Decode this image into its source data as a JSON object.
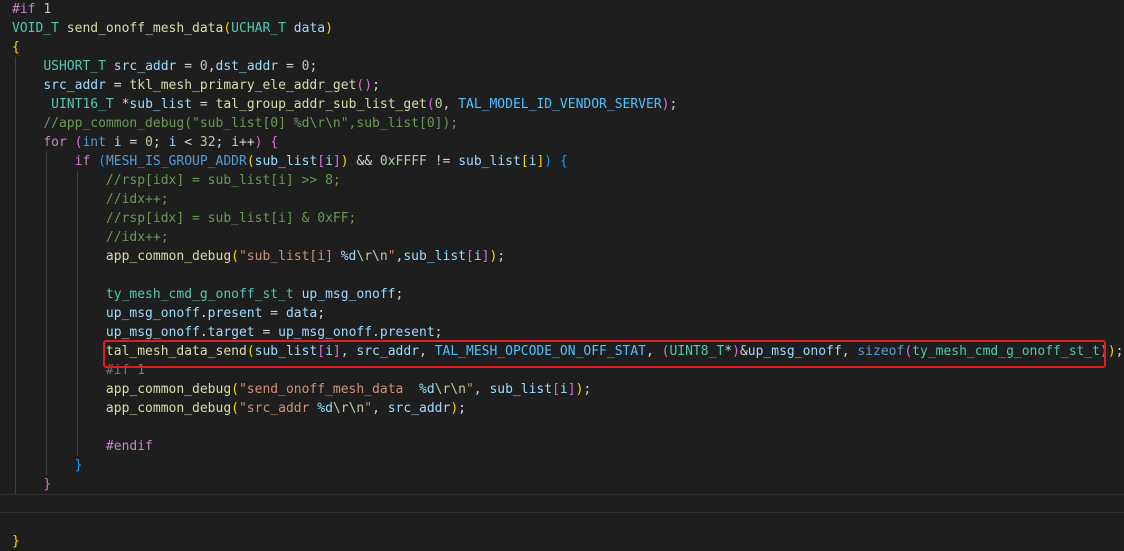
{
  "colors": {
    "background": "#1e1e1e",
    "keyword": "#569cd6",
    "control": "#c586c0",
    "type": "#4ec9b0",
    "function": "#dcdcaa",
    "variable": "#9cdcfe",
    "number": "#b5cea8",
    "string": "#ce9178",
    "comment": "#6a9955",
    "macro": "#4fc1ff",
    "plain": "#d4d4d4",
    "inactive": "#7a7a7a",
    "bracket1": "#ffd700",
    "bracket2": "#da70d6",
    "bracket3": "#179fff",
    "highlight_box": "#e01e1e"
  },
  "lines": [
    [
      [
        "#if ",
        "control"
      ],
      [
        "1",
        "number"
      ]
    ],
    [
      [
        "VOID_T",
        "type"
      ],
      [
        " ",
        "plain"
      ],
      [
        "send_onoff_mesh_data",
        "function"
      ],
      [
        "(",
        "bracket1"
      ],
      [
        "UCHAR_T",
        "type"
      ],
      [
        " ",
        "plain"
      ],
      [
        "data",
        "variable"
      ],
      [
        ")",
        "bracket1"
      ]
    ],
    [
      [
        "{",
        "bracket1"
      ]
    ],
    [
      [
        "    ",
        "plain"
      ],
      [
        "USHORT_T",
        "type"
      ],
      [
        " ",
        "plain"
      ],
      [
        "src_addr",
        "variable"
      ],
      [
        " = ",
        "plain"
      ],
      [
        "0",
        "number"
      ],
      [
        ",",
        "plain"
      ],
      [
        "dst_addr",
        "variable"
      ],
      [
        " = ",
        "plain"
      ],
      [
        "0",
        "number"
      ],
      [
        ";",
        "plain"
      ]
    ],
    [
      [
        "    ",
        "plain"
      ],
      [
        "src_addr",
        "variable"
      ],
      [
        " = ",
        "plain"
      ],
      [
        "tkl_mesh_primary_ele_addr_get",
        "function"
      ],
      [
        "()",
        "bracket2"
      ],
      [
        ";",
        "plain"
      ]
    ],
    [
      [
        "     ",
        "plain"
      ],
      [
        "UINT16_T",
        "type"
      ],
      [
        " *",
        "plain"
      ],
      [
        "sub_list",
        "variable"
      ],
      [
        " = ",
        "plain"
      ],
      [
        "tal_group_addr_sub_list_get",
        "function"
      ],
      [
        "(",
        "bracket2"
      ],
      [
        "0",
        "number"
      ],
      [
        ", ",
        "plain"
      ],
      [
        "TAL_MODEL_ID_VENDOR_SERVER",
        "macro"
      ],
      [
        ")",
        "bracket2"
      ],
      [
        ";",
        "plain"
      ]
    ],
    [
      [
        "    ",
        "plain"
      ],
      [
        "//app_common_debug(\"sub_list[0] %d\\r\\n\",sub_list[0]);",
        "comment"
      ]
    ],
    [
      [
        "    ",
        "plain"
      ],
      [
        "for",
        "control"
      ],
      [
        " ",
        "plain"
      ],
      [
        "(",
        "bracket2"
      ],
      [
        "int",
        "keyword"
      ],
      [
        " ",
        "plain"
      ],
      [
        "i",
        "variable"
      ],
      [
        " = ",
        "plain"
      ],
      [
        "0",
        "number"
      ],
      [
        "; ",
        "plain"
      ],
      [
        "i",
        "variable"
      ],
      [
        " < ",
        "plain"
      ],
      [
        "32",
        "number"
      ],
      [
        "; ",
        "plain"
      ],
      [
        "i",
        "variable"
      ],
      [
        "++",
        "plain"
      ],
      [
        ")",
        "bracket2"
      ],
      [
        " ",
        "plain"
      ],
      [
        "{",
        "bracket2"
      ]
    ],
    [
      [
        "        ",
        "plain"
      ],
      [
        "if",
        "control"
      ],
      [
        " ",
        "plain"
      ],
      [
        "(",
        "bracket3"
      ],
      [
        "MESH_IS_GROUP_ADDR",
        "keyword"
      ],
      [
        "(",
        "bracket1"
      ],
      [
        "sub_list",
        "variable"
      ],
      [
        "[",
        "bracket2"
      ],
      [
        "i",
        "variable"
      ],
      [
        "]",
        "bracket2"
      ],
      [
        ")",
        "bracket1"
      ],
      [
        " && ",
        "plain"
      ],
      [
        "0xFFFF",
        "number"
      ],
      [
        " != ",
        "plain"
      ],
      [
        "sub_list",
        "variable"
      ],
      [
        "[",
        "bracket1"
      ],
      [
        "i",
        "variable"
      ],
      [
        "]",
        "bracket1"
      ],
      [
        ")",
        "bracket3"
      ],
      [
        " ",
        "plain"
      ],
      [
        "{",
        "bracket3"
      ]
    ],
    [
      [
        "            ",
        "plain"
      ],
      [
        "//rsp[idx] = sub_list[i] >> 8;",
        "comment"
      ]
    ],
    [
      [
        "            ",
        "plain"
      ],
      [
        "//idx++;",
        "comment"
      ]
    ],
    [
      [
        "            ",
        "plain"
      ],
      [
        "//rsp[idx] = sub_list[i] & 0xFF;",
        "comment"
      ]
    ],
    [
      [
        "            ",
        "plain"
      ],
      [
        "//idx++;",
        "comment"
      ]
    ],
    [
      [
        "            ",
        "plain"
      ],
      [
        "app_common_debug",
        "function"
      ],
      [
        "(",
        "bracket1"
      ],
      [
        "\"sub_list[i] ",
        "string"
      ],
      [
        "%d",
        "variable"
      ],
      [
        "\\r\\n",
        "number"
      ],
      [
        "\"",
        "string"
      ],
      [
        ",",
        "plain"
      ],
      [
        "sub_list",
        "variable"
      ],
      [
        "[",
        "bracket2"
      ],
      [
        "i",
        "variable"
      ],
      [
        "]",
        "bracket2"
      ],
      [
        ")",
        "bracket1"
      ],
      [
        ";",
        "plain"
      ]
    ],
    [],
    [
      [
        "            ",
        "plain"
      ],
      [
        "ty_mesh_cmd_g_onoff_st_t",
        "type"
      ],
      [
        " ",
        "plain"
      ],
      [
        "up_msg_onoff",
        "variable"
      ],
      [
        ";",
        "plain"
      ]
    ],
    [
      [
        "            ",
        "plain"
      ],
      [
        "up_msg_onoff",
        "variable"
      ],
      [
        ".",
        "plain"
      ],
      [
        "present",
        "variable"
      ],
      [
        " = ",
        "plain"
      ],
      [
        "data",
        "variable"
      ],
      [
        ";",
        "plain"
      ]
    ],
    [
      [
        "            ",
        "plain"
      ],
      [
        "up_msg_onoff",
        "variable"
      ],
      [
        ".",
        "plain"
      ],
      [
        "target",
        "variable"
      ],
      [
        " = ",
        "plain"
      ],
      [
        "up_msg_onoff",
        "variable"
      ],
      [
        ".",
        "plain"
      ],
      [
        "present",
        "variable"
      ],
      [
        ";",
        "plain"
      ]
    ],
    [
      [
        "            ",
        "plain"
      ],
      [
        "tal_mesh_data_send",
        "function"
      ],
      [
        "(",
        "bracket1"
      ],
      [
        "sub_list",
        "variable"
      ],
      [
        "[",
        "bracket2"
      ],
      [
        "i",
        "variable"
      ],
      [
        "]",
        "bracket2"
      ],
      [
        ", ",
        "plain"
      ],
      [
        "src_addr",
        "variable"
      ],
      [
        ", ",
        "plain"
      ],
      [
        "TAL_MESH_OPCODE_ON_OFF_STAT",
        "macro"
      ],
      [
        ", ",
        "plain"
      ],
      [
        "(",
        "bracket2"
      ],
      [
        "UINT8_T",
        "type"
      ],
      [
        "*",
        "plain"
      ],
      [
        ")",
        "bracket2"
      ],
      [
        "&",
        "plain"
      ],
      [
        "up_msg_onoff",
        "variable"
      ],
      [
        ", ",
        "plain"
      ],
      [
        "sizeof",
        "keyword"
      ],
      [
        "(",
        "bracket2"
      ],
      [
        "ty_mesh_cmd_g_onoff_st_t",
        "type"
      ],
      [
        ")",
        "bracket2"
      ],
      [
        ")",
        "bracket1"
      ],
      [
        ";",
        "plain"
      ]
    ],
    [
      [
        "            ",
        "plain"
      ],
      [
        "#if 1",
        "inactive"
      ]
    ],
    [
      [
        "            ",
        "plain"
      ],
      [
        "app_common_debug",
        "function"
      ],
      [
        "(",
        "bracket1"
      ],
      [
        "\"send_onoff_mesh_data  ",
        "string"
      ],
      [
        "%d",
        "variable"
      ],
      [
        "\\r\\n",
        "number"
      ],
      [
        "\"",
        "string"
      ],
      [
        ", ",
        "plain"
      ],
      [
        "sub_list",
        "variable"
      ],
      [
        "[",
        "bracket2"
      ],
      [
        "i",
        "variable"
      ],
      [
        "]",
        "bracket2"
      ],
      [
        ")",
        "bracket1"
      ],
      [
        ";",
        "plain"
      ]
    ],
    [
      [
        "            ",
        "plain"
      ],
      [
        "app_common_debug",
        "function"
      ],
      [
        "(",
        "bracket1"
      ],
      [
        "\"src_addr ",
        "string"
      ],
      [
        "%d",
        "variable"
      ],
      [
        "\\r\\n",
        "number"
      ],
      [
        "\"",
        "string"
      ],
      [
        ", ",
        "plain"
      ],
      [
        "src_addr",
        "variable"
      ],
      [
        ")",
        "bracket1"
      ],
      [
        ";",
        "plain"
      ]
    ],
    [],
    [
      [
        "            ",
        "plain"
      ],
      [
        "#endif",
        "control"
      ]
    ],
    [
      [
        "        ",
        "plain"
      ],
      [
        "}",
        "bracket3"
      ]
    ],
    [
      [
        "    ",
        "plain"
      ],
      [
        "}",
        "bracket2"
      ]
    ],
    [],
    [],
    [
      [
        "}",
        "bracket1"
      ]
    ]
  ]
}
